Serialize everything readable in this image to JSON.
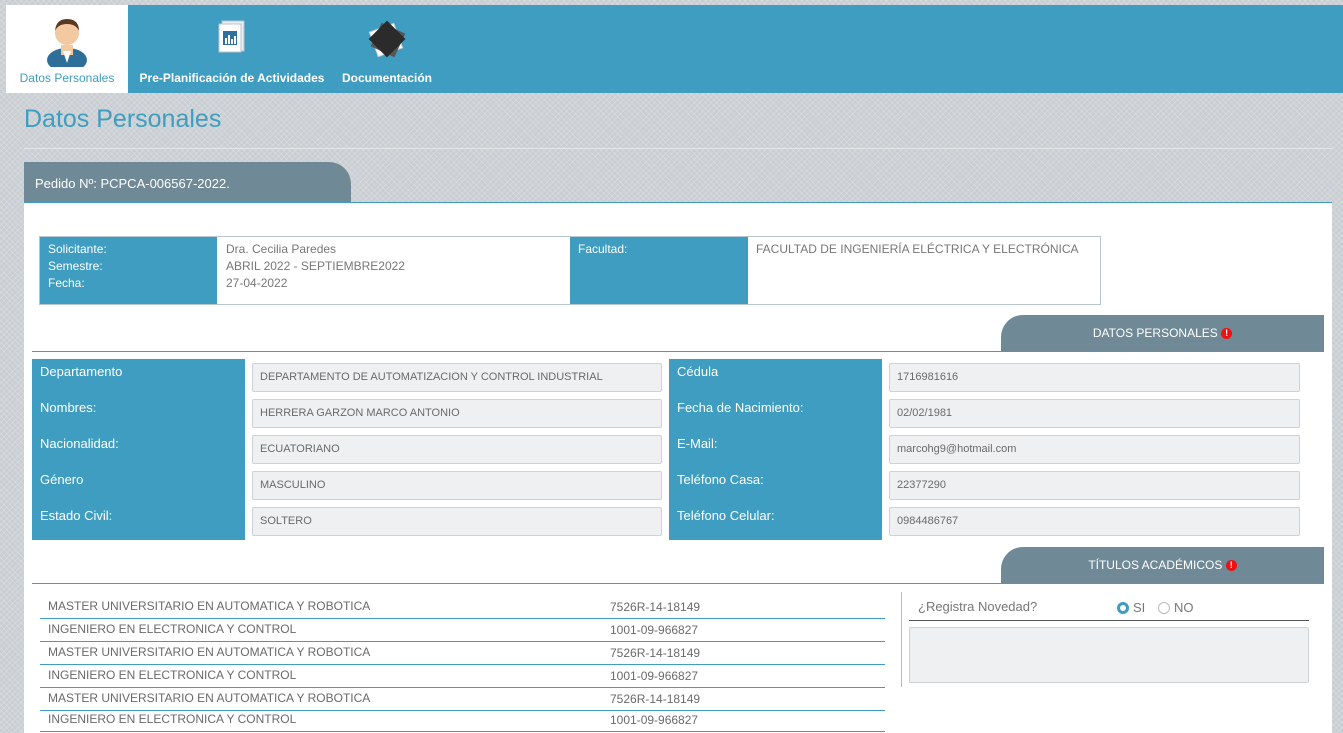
{
  "nav": [
    {
      "label": "Datos Personales",
      "icon": "user-avatar-icon"
    },
    {
      "label": "Pre-Planificación de Actividades",
      "icon": "report-document-icon"
    },
    {
      "label": "Documentación",
      "icon": "documents-stack-icon"
    }
  ],
  "page_title": "Datos Personales",
  "pedido": "Pedido Nº: PCPCA-006567-2022.",
  "summary": {
    "solicitante_label": "Solicitante:",
    "solicitante": "Dra. Cecilia Paredes",
    "semestre_label": "Semestre:",
    "semestre": "ABRIL 2022 - SEPTIEMBRE2022",
    "fecha_label": "Fecha:",
    "fecha": "27-04-2022",
    "facultad_label": "Facultad:",
    "facultad": "FACULTAD DE INGENIERÍA ELÉCTRICA Y ELECTRÓNICA"
  },
  "datos_tab": "DATOS PERSONALES",
  "fields_left": [
    {
      "label": "Departamento",
      "value": "DEPARTAMENTO DE AUTOMATIZACION Y CONTROL INDUSTRIAL"
    },
    {
      "label": "Nombres:",
      "value": "HERRERA GARZON MARCO ANTONIO"
    },
    {
      "label": "Nacionalidad:",
      "value": "ECUATORIANO"
    },
    {
      "label": "Género",
      "value": "MASCULINO"
    },
    {
      "label": "Estado Civil:",
      "value": "SOLTERO"
    }
  ],
  "fields_right": [
    {
      "label": "Cédula",
      "value": "1716981616"
    },
    {
      "label": "Fecha de Nacimiento:",
      "value": "02/02/1981"
    },
    {
      "label": "E-Mail:",
      "value": "marcohg9@hotmail.com"
    },
    {
      "label": "Teléfono Casa:",
      "value": "22377290"
    },
    {
      "label": "Teléfono Celular:",
      "value": "0984486767"
    }
  ],
  "titulos_tab": "TÍTULOS ACADÉMICOS",
  "titulos": [
    {
      "name": "MASTER UNIVERSITARIO EN AUTOMATICA Y ROBOTICA",
      "code": "7526R-14-18149"
    },
    {
      "name": "INGENIERO EN ELECTRONICA Y CONTROL",
      "code": "1001-09-966827"
    },
    {
      "name": "MASTER UNIVERSITARIO EN AUTOMATICA Y ROBOTICA",
      "code": "7526R-14-18149"
    },
    {
      "name": "INGENIERO EN ELECTRONICA Y CONTROL",
      "code": "1001-09-966827"
    },
    {
      "name": "MASTER UNIVERSITARIO EN AUTOMATICA Y ROBOTICA",
      "code": "7526R-14-18149"
    },
    {
      "name": "INGENIERO EN ELECTRONICA Y CONTROL",
      "code": "1001-09-966827"
    }
  ],
  "novedad": {
    "question": "¿Registra Novedad?",
    "si": "SI",
    "no": "NO",
    "selected": "SI"
  },
  "colors": {
    "accent": "#3e9dc0",
    "tab_gray": "#6f8997",
    "alert": "#e11111"
  }
}
